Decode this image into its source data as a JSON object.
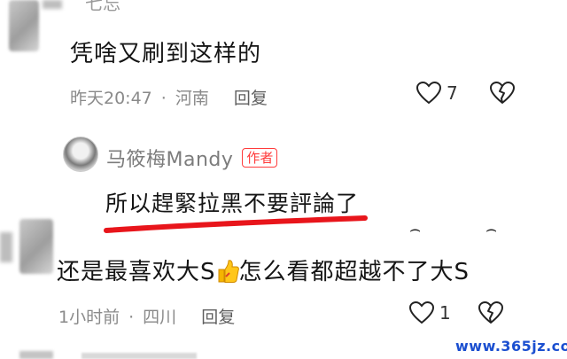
{
  "comment1": {
    "username": "七忘",
    "text": "凭啥又刷到这样的",
    "time": "昨天20:47",
    "location": "河南",
    "reply_label": "回复",
    "like_count": "7"
  },
  "reply": {
    "username": "马筱梅Mandy",
    "badge": "作者",
    "text": "所以趕緊拉黑不要評論了"
  },
  "comment2": {
    "text_before": "还是最喜欢大S",
    "text_after": "怎么看都超越不了大S",
    "time": "1小时前",
    "location": "四川",
    "reply_label": "回复",
    "like_count": "1"
  },
  "separator": "·",
  "watermark": "www.365jz.com",
  "colors": {
    "highlight": "#e8151b",
    "badge": "#ff3b3b",
    "meta": "#8a8a8a",
    "watermark": "#1b4fd0"
  },
  "icons": [
    "heart-icon",
    "broken-heart-icon",
    "thumbs-up-emoji"
  ]
}
